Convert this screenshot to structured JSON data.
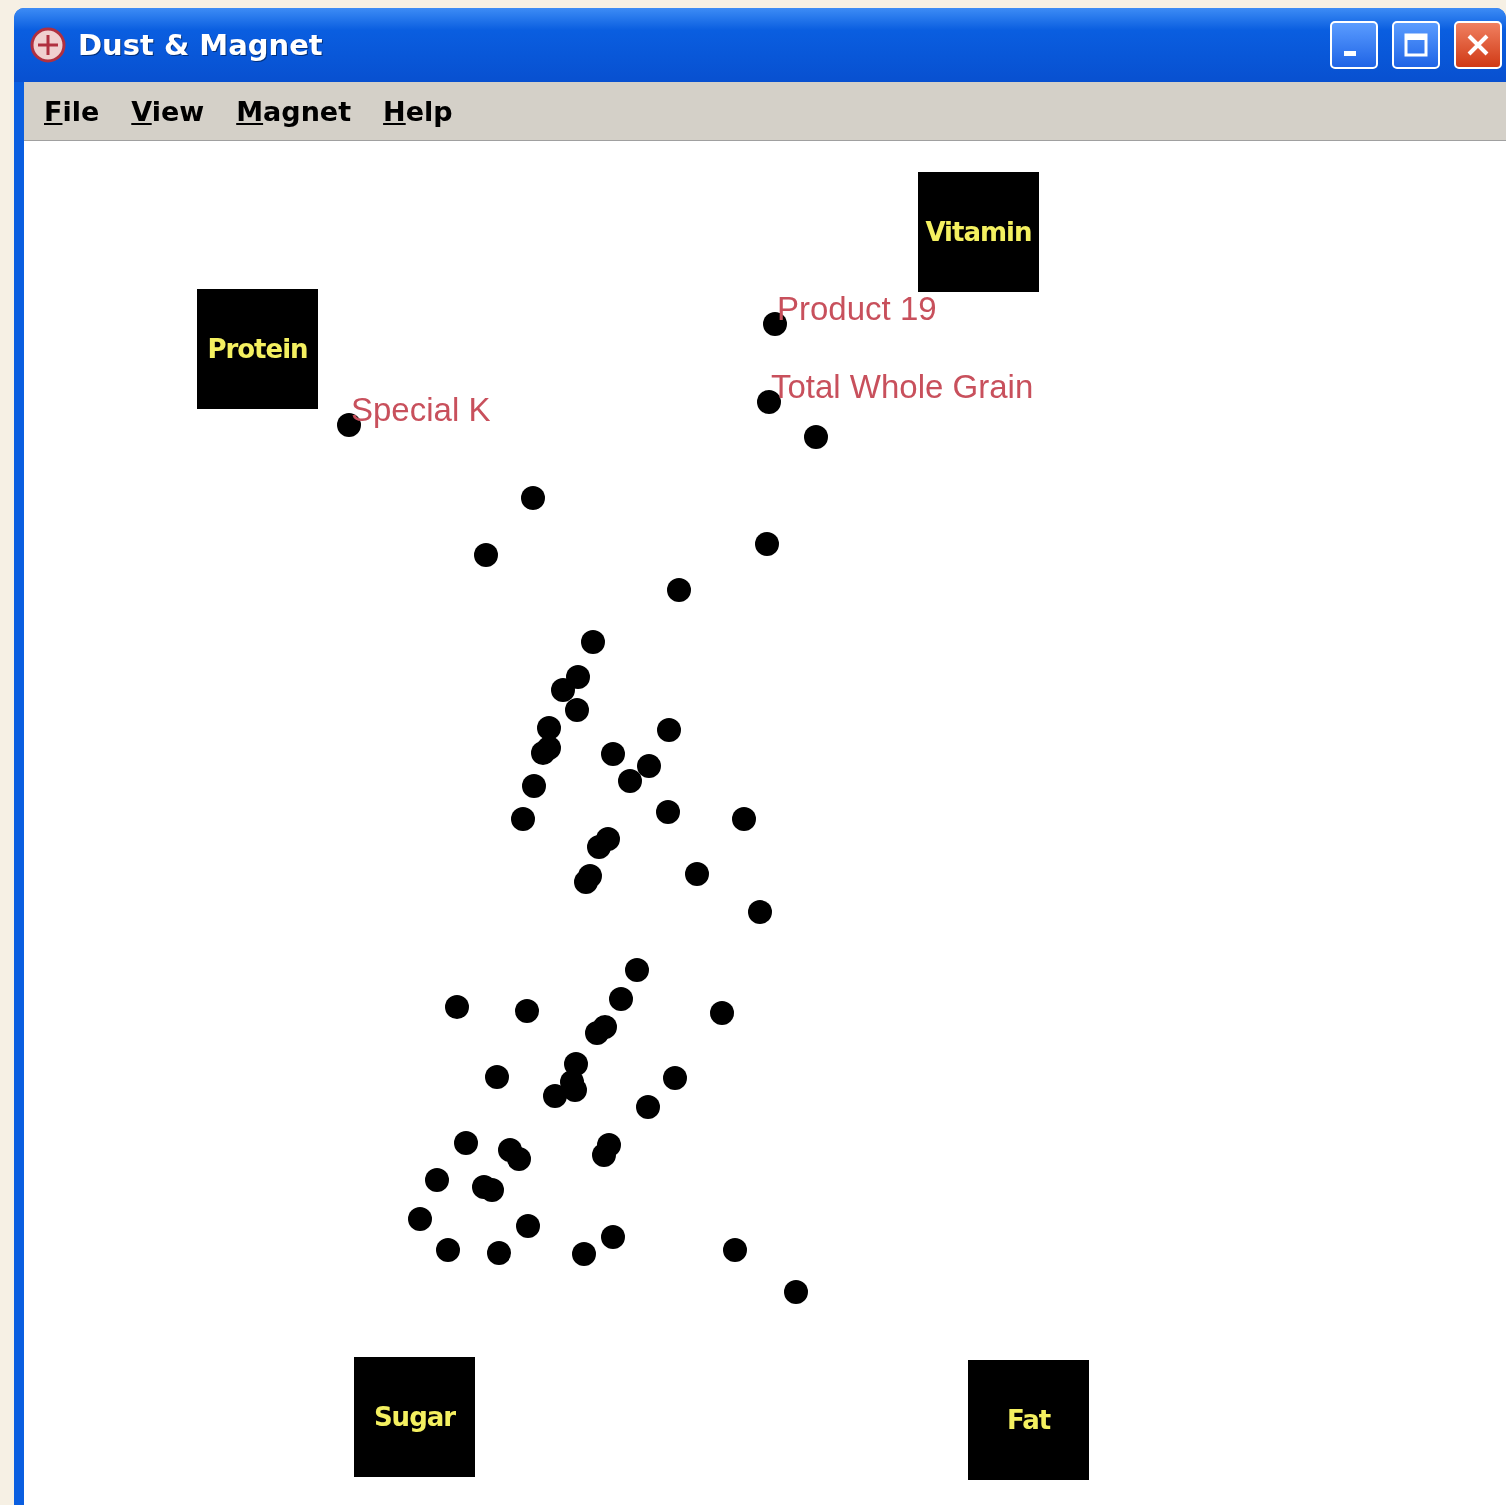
{
  "window": {
    "title": "Dust & Magnet"
  },
  "menu": [
    {
      "label": "File"
    },
    {
      "label": "View"
    },
    {
      "label": "Magnet"
    },
    {
      "label": "Help"
    }
  ],
  "magnets": [
    {
      "label": "Vitamin"
    },
    {
      "label": "Protein"
    },
    {
      "label": "Sugar"
    },
    {
      "label": "Fat"
    }
  ],
  "labeled_dust": [
    {
      "label": "Special K"
    },
    {
      "label": "Product 19"
    },
    {
      "label": "Total Whole Grain"
    }
  ]
}
